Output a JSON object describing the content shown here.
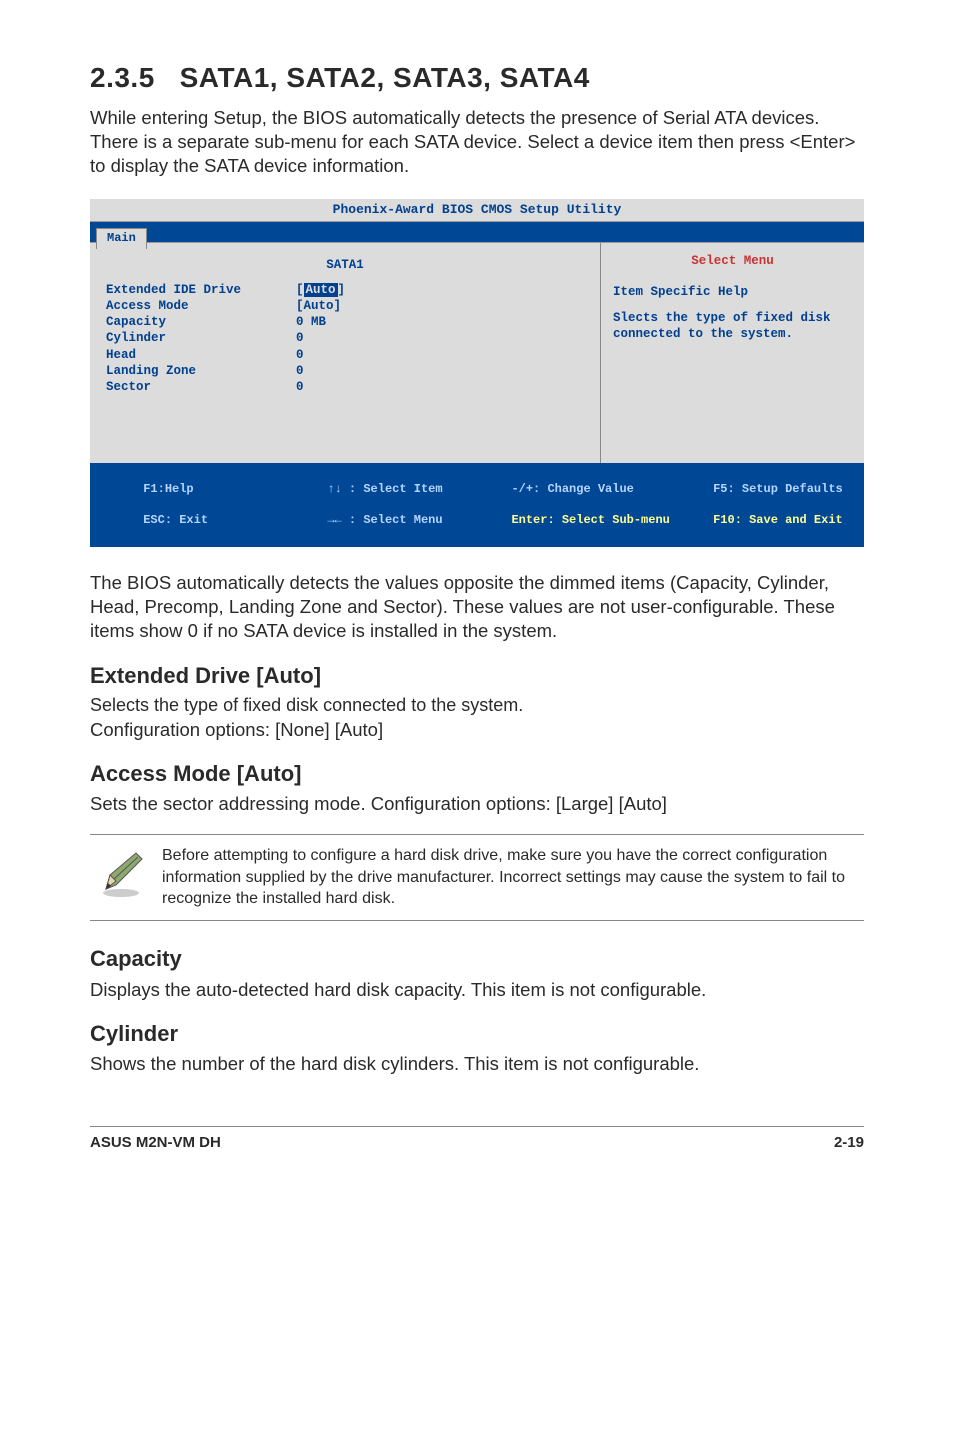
{
  "section": {
    "number": "2.3.5",
    "title": "SATA1, SATA2, SATA3, SATA4",
    "intro": "While entering Setup, the BIOS automatically detects the presence of Serial ATA devices. There is a separate sub-menu for each SATA device. Select a device item then press <Enter> to display the SATA device information."
  },
  "bios": {
    "window_title": "Phoenix-Award BIOS CMOS Setup Utility",
    "tab": "Main",
    "left_header": "SATA1",
    "rows": [
      {
        "label": "Extended IDE Drive",
        "value": "Auto",
        "highlight": true
      },
      {
        "label": "Access Mode",
        "value": "[Auto]"
      },
      {
        "label": "",
        "value": ""
      },
      {
        "label": "Capacity",
        "value": "0 MB"
      },
      {
        "label": "",
        "value": ""
      },
      {
        "label": "Cylinder",
        "value": "0"
      },
      {
        "label": "Head",
        "value": "0"
      },
      {
        "label": "Landing Zone",
        "value": "0"
      },
      {
        "label": "Sector",
        "value": "0"
      }
    ],
    "right_header": "Select Menu",
    "right_help_title": "Item Specific Help",
    "right_help_body": "Slects the type of fixed disk connected to the system.",
    "footer": {
      "c1a": "F1:Help",
      "c1b": "ESC: Exit",
      "c2a": "↑↓ : Select Item",
      "c2b": "→← : Select Menu",
      "c3a": "-/+: Change Value",
      "c3b": "Enter: Select Sub-menu",
      "c4a": "F5: Setup Defaults",
      "c4b": "F10: Save and Exit"
    }
  },
  "after_bios": "The BIOS automatically detects the values opposite the dimmed items (Capacity, Cylinder,  Head, Precomp, Landing Zone and Sector). These values are not user-configurable. These items show 0 if no SATA device is installed in the system.",
  "extended_drive": {
    "heading": "Extended Drive [Auto]",
    "line1": "Selects the type of fixed disk connected to the system.",
    "line2": "Configuration options: [None] [Auto]"
  },
  "access_mode": {
    "heading": "Access Mode [Auto]",
    "line1": "Sets the sector addressing mode. Configuration options: [Large] [Auto]"
  },
  "note": "Before attempting to configure a hard disk drive, make sure you have the correct configuration information supplied by the drive manufacturer. Incorrect settings may cause the system to fail to recognize the installed hard disk.",
  "capacity": {
    "heading": "Capacity",
    "body": "Displays the auto-detected hard disk capacity. This item is not configurable."
  },
  "cylinder": {
    "heading": "Cylinder",
    "body": "Shows the number of the hard disk cylinders. This item is not configurable."
  },
  "footer": {
    "left": "ASUS M2N-VM DH",
    "right": "2-19"
  }
}
